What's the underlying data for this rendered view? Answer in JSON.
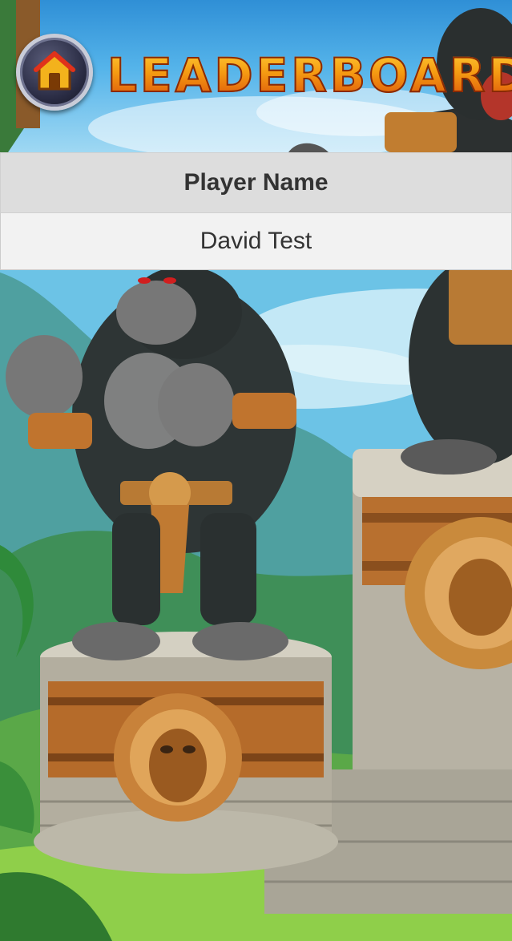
{
  "header": {
    "title": "LEADERBOARD",
    "home_icon": "home-icon"
  },
  "table": {
    "columns": [
      "Player Name"
    ],
    "rows": [
      [
        "David Test"
      ]
    ]
  },
  "colors": {
    "title_top": "#ffd23a",
    "title_bottom": "#d94a0a",
    "header_row_bg": "#dddddd",
    "body_row_bg": "#f2f2f2",
    "text": "#333333"
  }
}
